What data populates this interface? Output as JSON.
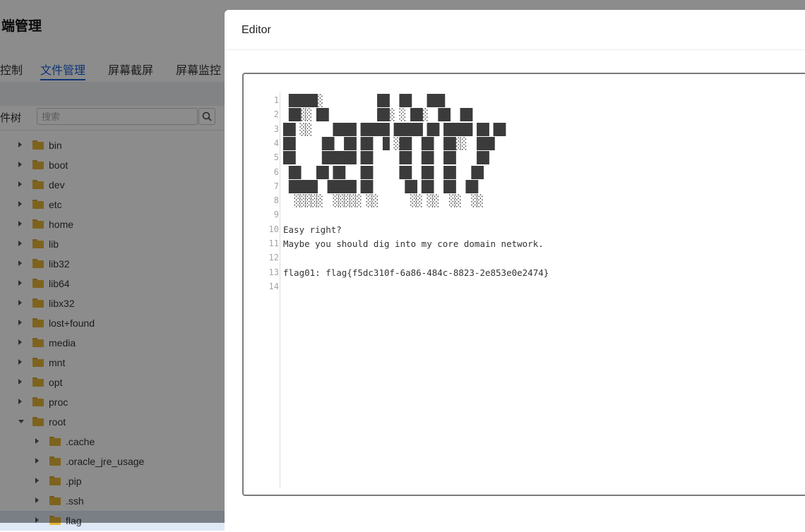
{
  "app": {
    "title": "端管理",
    "tabs": [
      "控制",
      "文件管理",
      "屏幕截屏",
      "屏幕监控"
    ],
    "active_tab": "文件管理",
    "tree_label": "件树",
    "search_placeholder": "搜索",
    "menu_glyph": "⋮",
    "tree": [
      {
        "name": "bin",
        "expanded": false,
        "depth": 0
      },
      {
        "name": "boot",
        "expanded": false,
        "depth": 0
      },
      {
        "name": "dev",
        "expanded": false,
        "depth": 0
      },
      {
        "name": "etc",
        "expanded": false,
        "depth": 0
      },
      {
        "name": "home",
        "expanded": false,
        "depth": 0
      },
      {
        "name": "lib",
        "expanded": false,
        "depth": 0
      },
      {
        "name": "lib32",
        "expanded": false,
        "depth": 0
      },
      {
        "name": "lib64",
        "expanded": false,
        "depth": 0
      },
      {
        "name": "libx32",
        "expanded": false,
        "depth": 0
      },
      {
        "name": "lost+found",
        "expanded": false,
        "depth": 0
      },
      {
        "name": "media",
        "expanded": false,
        "depth": 0
      },
      {
        "name": "mnt",
        "expanded": false,
        "depth": 0
      },
      {
        "name": "opt",
        "expanded": false,
        "depth": 0
      },
      {
        "name": "proc",
        "expanded": false,
        "depth": 0
      },
      {
        "name": "root",
        "expanded": true,
        "depth": 0
      },
      {
        "name": ".cache",
        "expanded": false,
        "depth": 1
      },
      {
        "name": ".oracle_jre_usage",
        "expanded": false,
        "depth": 1
      },
      {
        "name": ".pip",
        "expanded": false,
        "depth": 1
      },
      {
        "name": ".ssh",
        "expanded": false,
        "depth": 1
      },
      {
        "name": "flag",
        "expanded": false,
        "depth": 1,
        "selected": true
      }
    ]
  },
  "dialog": {
    "title": "Editor",
    "lines": [
      " █████░          ██  ██   ███",
      " ██░░ ██         ██░ ░ ██░  ██  ██",
      "██ ░░    ████ █████ █████ ██ █████ ██ ██",
      "██     ██  ██ ██  █ ░██  ██  ██░░  ███",
      "██     ██████ ██     ██  ██  ██    ██",
      " ██   ██ ██   ██     ██  ██  ██   ██",
      " █████  █████ ██      ██ ██  ██  ██",
      "  ░░░░░  ░░░░░ ░░      ░░ ░░  ░░  ░░",
      "",
      "Easy right?",
      "Maybe you should dig into my core domain network.",
      "",
      "flag01: flag{f5dc310f-6a86-484c-8823-2e853e0e2474}",
      ""
    ]
  }
}
